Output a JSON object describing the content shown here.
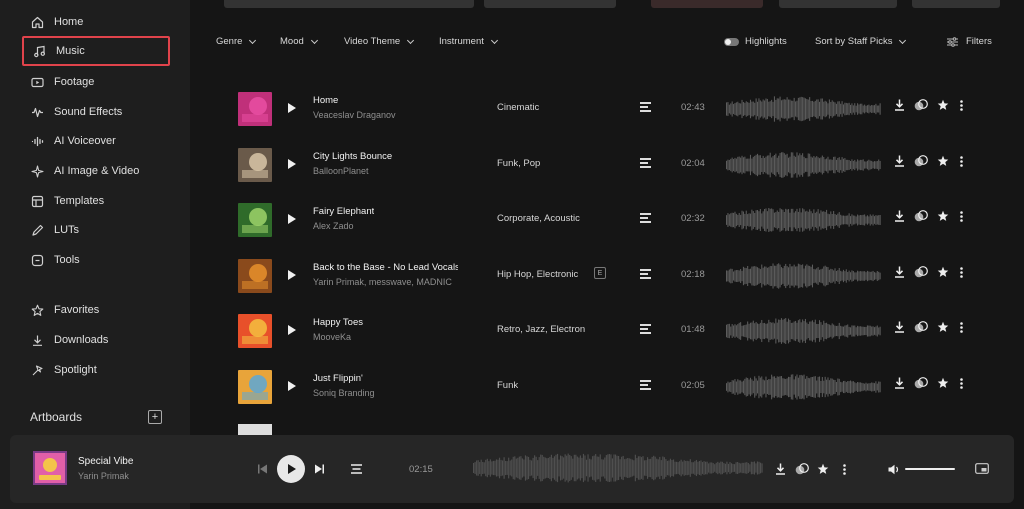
{
  "sidebar": {
    "items": [
      {
        "label": "Home",
        "icon": "home-icon"
      },
      {
        "label": "Music",
        "icon": "music-note-icon",
        "active": true
      },
      {
        "label": "Footage",
        "icon": "video-icon"
      },
      {
        "label": "Sound Effects",
        "icon": "waveform-icon"
      },
      {
        "label": "AI Voiceover",
        "icon": "voice-icon"
      },
      {
        "label": "AI Image & Video",
        "icon": "sparkle-icon"
      },
      {
        "label": "Templates",
        "icon": "templates-icon"
      },
      {
        "label": "LUTs",
        "icon": "lut-icon"
      },
      {
        "label": "Tools",
        "icon": "tools-icon"
      }
    ],
    "secondary": [
      {
        "label": "Favorites",
        "icon": "star-outline-icon"
      },
      {
        "label": "Downloads",
        "icon": "download-icon"
      },
      {
        "label": "Spotlight",
        "icon": "spotlight-icon"
      }
    ],
    "artboards_label": "Artboards",
    "active_border_color": "#e0434b"
  },
  "filters": {
    "genre": "Genre",
    "mood": "Mood",
    "video_theme": "Video Theme",
    "instrument": "Instrument",
    "highlights": "Highlights",
    "sort": "Sort by Staff Picks",
    "filters_button": "Filters"
  },
  "tracks": [
    {
      "title": "Home",
      "artist": "Veaceslav Draganov",
      "genre": "Cinematic",
      "duration": "02:43",
      "explicit": false,
      "thumb_colors": [
        "#c0307a",
        "#e94fa3"
      ]
    },
    {
      "title": "City Lights Bounce",
      "artist": "BalloonPlanet",
      "genre": "Funk, Pop",
      "duration": "02:04",
      "explicit": false,
      "thumb_colors": [
        "#6a5a4a",
        "#d9c7a8"
      ]
    },
    {
      "title": "Fairy Elephant",
      "artist": "Alex Zado",
      "genre": "Corporate, Acoustic",
      "duration": "02:32",
      "explicit": false,
      "thumb_colors": [
        "#2f6b2a",
        "#9ed36a"
      ]
    },
    {
      "title": "Back to the Base - No Lead Vocals",
      "artist": "Yarin Primak, messwave, MADNIC",
      "genre": "Hip Hop, Electronic",
      "duration": "02:18",
      "explicit": true,
      "thumb_colors": [
        "#8a4a1c",
        "#e8902c"
      ]
    },
    {
      "title": "Happy Toes",
      "artist": "MooveKa",
      "genre": "Retro, Jazz, Electronic",
      "duration": "01:48",
      "explicit": false,
      "thumb_colors": [
        "#e8502a",
        "#f4c040"
      ]
    },
    {
      "title": "Just Flippin'",
      "artist": "Soniq Branding",
      "genre": "Funk",
      "duration": "02:05",
      "explicit": false,
      "thumb_colors": [
        "#e8a43a",
        "#5aa8d8"
      ]
    }
  ],
  "explicit_badge": "E",
  "player": {
    "title": "Special Vibe",
    "artist": "Yarin Primak",
    "time": "02:15",
    "volume": 1.0,
    "thumb_colors": [
      "#e15fa8",
      "#f3c44a"
    ]
  }
}
